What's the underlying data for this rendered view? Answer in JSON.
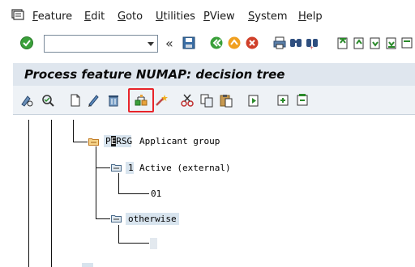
{
  "menu": {
    "items": [
      {
        "label": "Feature",
        "underline": "F",
        "rest": "eature"
      },
      {
        "label": "Edit",
        "underline": "E",
        "rest": "dit"
      },
      {
        "label": "Goto",
        "underline": "G",
        "rest": "oto"
      },
      {
        "label": "Utilities",
        "underline": "U",
        "rest": "tilities"
      },
      {
        "label": "PView",
        "underline": "P",
        "rest": "View"
      },
      {
        "label": "System",
        "underline": "S",
        "rest": "ystem"
      },
      {
        "label": "Help",
        "underline": "H",
        "rest": "elp"
      }
    ]
  },
  "toolbar": {
    "command_value": "",
    "separator_glyph": "«"
  },
  "title": "Process feature NUMAP: decision tree",
  "tree": {
    "node_persg": {
      "key_pre": "P",
      "key_cursor": "E",
      "key_post": "RSG",
      "label": "Applicant group"
    },
    "node_active": {
      "key": "1",
      "label": "Active (external)"
    },
    "leaf_value": "01",
    "node_otherwise": {
      "label": "otherwise"
    }
  },
  "colors": {
    "highlight": "#e8242a",
    "title_bg": "#dfe6ee",
    "appbar_bg": "#eef2f6",
    "folder": "#e8a33c",
    "node_bg": "#d8e4ee"
  }
}
